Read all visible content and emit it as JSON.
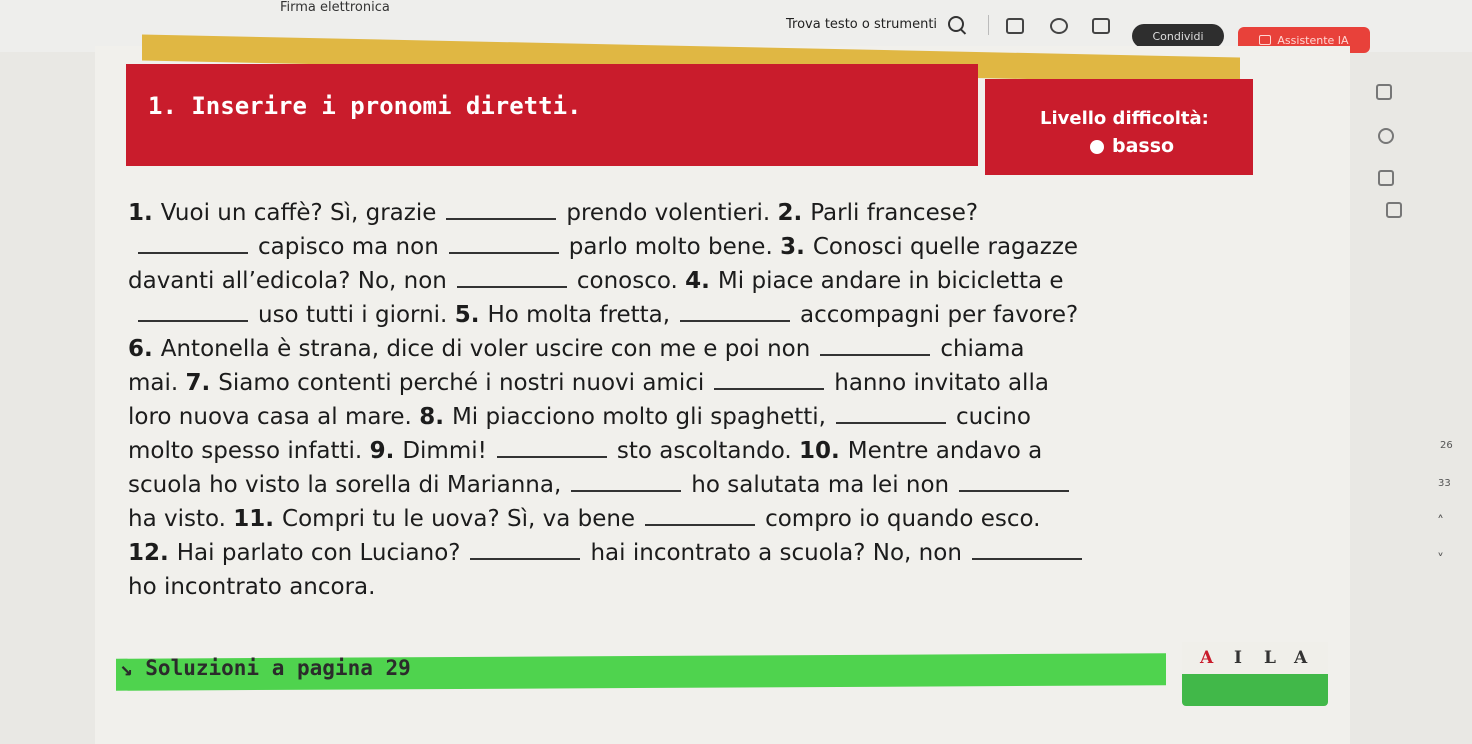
{
  "toolbar": {
    "window_title": "Firma elettronica",
    "search_label": "Trova testo o strumenti",
    "share_label": "Condividi",
    "assistant_label": "Assistente IA"
  },
  "exercise": {
    "title": "1. Inserire i pronomi diretti.",
    "level_label": "Livello difficoltà:",
    "level_value": "basso",
    "lines": [
      [
        "1. ",
        "Vuoi un caffè? Sì, grazie",
        "_",
        "prendo volentieri. ",
        "2. ",
        "Parli francese?"
      ],
      [
        "_",
        "capisco ma non",
        "_",
        "parlo molto bene. ",
        "3. ",
        "Conosci quelle ragazze"
      ],
      [
        "davanti all’edicola? No, non",
        "_",
        "conosco. ",
        "4. ",
        "Mi piace andare in bicicletta e"
      ],
      [
        "_",
        "uso tutti i giorni. ",
        "5. ",
        "Ho molta fretta,",
        "_",
        "accompagni per favore?"
      ],
      [
        "6. ",
        "Antonella è strana, dice di voler uscire con me e poi non",
        "_",
        "chiama"
      ],
      [
        "mai. ",
        "7. ",
        "Siamo contenti perché i nostri nuovi amici",
        "_",
        "hanno invitato alla"
      ],
      [
        "loro nuova casa al mare. ",
        "8. ",
        "Mi piacciono molto gli spaghetti,",
        "_",
        "cucino"
      ],
      [
        "molto spesso infatti. ",
        "9. ",
        "Dimmi!",
        "_",
        "sto ascoltando. ",
        "10. ",
        "Mentre andavo a"
      ],
      [
        "scuola ho visto la sorella di Marianna,",
        "_",
        "ho salutata ma lei non",
        "_"
      ],
      [
        "ha visto. ",
        "11. ",
        "Compri tu le uova? Sì, va bene",
        "_",
        "compro io quando esco."
      ],
      [
        "12. ",
        "Hai parlato con Luciano?",
        "_",
        "hai incontrato a scuola? No, non",
        "_"
      ],
      [
        "ho incontrato ancora."
      ]
    ]
  },
  "footer": {
    "solutions_text": "↘ Soluzioni a pagina 29",
    "logo_letters": [
      "A",
      "I",
      "L",
      "A"
    ]
  },
  "side_panel": {
    "page_numbers": [
      "26",
      "33"
    ]
  },
  "colors": {
    "banner": "#c91c2c",
    "accent_yellow": "#e0b743",
    "footer_green": "#4fd34e",
    "assistant": "#e8413a"
  }
}
